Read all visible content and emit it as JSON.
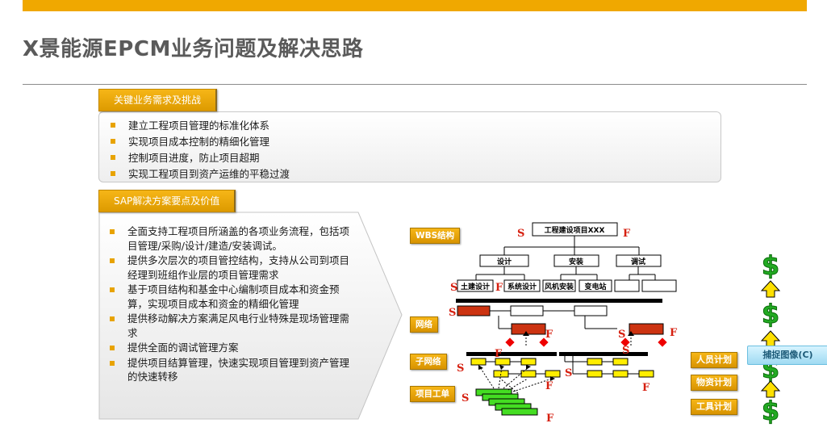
{
  "title": "X景能源EPCM业务问题及解决思路",
  "section1": {
    "tab": "关键业务需求及挑战",
    "bullets": [
      "建立工程项目管理的标准化体系",
      "实现项目成本控制的精细化管理",
      "控制项目进度，防止项目超期",
      "实现工程项目到资产运维的平稳过渡"
    ]
  },
  "section2": {
    "tab": "SAP解决方案要点及价值",
    "bullets": [
      "全面支持工程项目所涵盖的各项业务流程，包括项目管理/采购/设计/建造/安装调试。",
      "提供多次层次的项目管控结构，支持从公司到项目经理到班组作业层的项目管理需求",
      "基于项目结构和基金中心编制项目成本和资金预算，实现项目成本和资金的精细化管理",
      "提供移动解决方案满足风电行业特殊是现场管理需求",
      "提供全面的调试管理方案",
      "提供项目结算管理，快速实现项目管理到资产管理的快速转移"
    ]
  },
  "diagram": {
    "left_labels": {
      "wbs": "WBS结构",
      "network": "网络",
      "subnetwork": "子网络",
      "workorder": "项目工单"
    },
    "root_box": "工程建设项目XXX",
    "level2": [
      "设计",
      "安装",
      "调试"
    ],
    "level3": [
      "土建设计",
      "系统设计",
      "风机安装",
      "变电站"
    ],
    "s_label": "S",
    "f_label": "F",
    "right_labels": {
      "people": "人员计划",
      "material": "物资计划",
      "tool": "工具计划"
    },
    "colors": {
      "accent": "#f0a800",
      "activity_red": "#cc3311",
      "activity_yellow": "#ffee00",
      "workorder_green": "#44dd22",
      "milestone": "#ee0000",
      "dollar": "#22aa22"
    },
    "icons": [
      "dollar-icon",
      "up-arrow-icon"
    ]
  },
  "capture_button": "捕捉图像(C)"
}
